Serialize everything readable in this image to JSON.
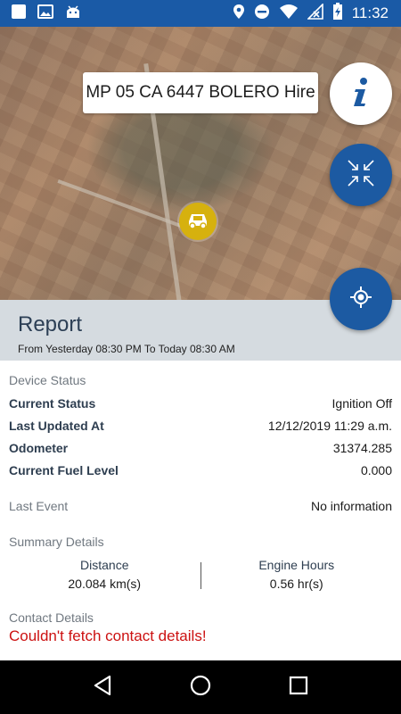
{
  "status_bar": {
    "time": "11:32",
    "left_icons": [
      "square-icon",
      "image-icon",
      "android-icon"
    ],
    "right_icons": [
      "location-icon",
      "do-not-disturb-icon",
      "wifi-icon",
      "signal-icon",
      "battery-icon"
    ]
  },
  "map": {
    "vehicle_title": "MP 05 CA 6447 BOLERO Hire",
    "buttons": {
      "info": "info-icon",
      "collapse": "collapse-arrows-icon",
      "locate": "my-location-icon"
    }
  },
  "report": {
    "title": "Report",
    "range": "From Yesterday 08:30 PM To Today 08:30 AM"
  },
  "device_status": {
    "section_title": "Device Status",
    "rows": [
      {
        "label": "Current Status",
        "value": "Ignition Off"
      },
      {
        "label": "Last Updated At",
        "value": "12/12/2019 11:29 a.m."
      },
      {
        "label": "Odometer",
        "value": "31374.285"
      },
      {
        "label": "Current Fuel Level",
        "value": "0.000"
      }
    ]
  },
  "last_event": {
    "label": "Last Event",
    "value": "No information"
  },
  "summary": {
    "section_title": "Summary Details",
    "distance_label": "Distance",
    "distance_value": "20.084 km(s)",
    "engine_hours_label": "Engine Hours",
    "engine_hours_value": "0.56 hr(s)"
  },
  "contact": {
    "section_title": "Contact Details",
    "error": "Couldn't fetch contact details!"
  },
  "colors": {
    "primary": "#1c5aa2",
    "marker": "#d6b10e",
    "error": "#cc1111"
  }
}
